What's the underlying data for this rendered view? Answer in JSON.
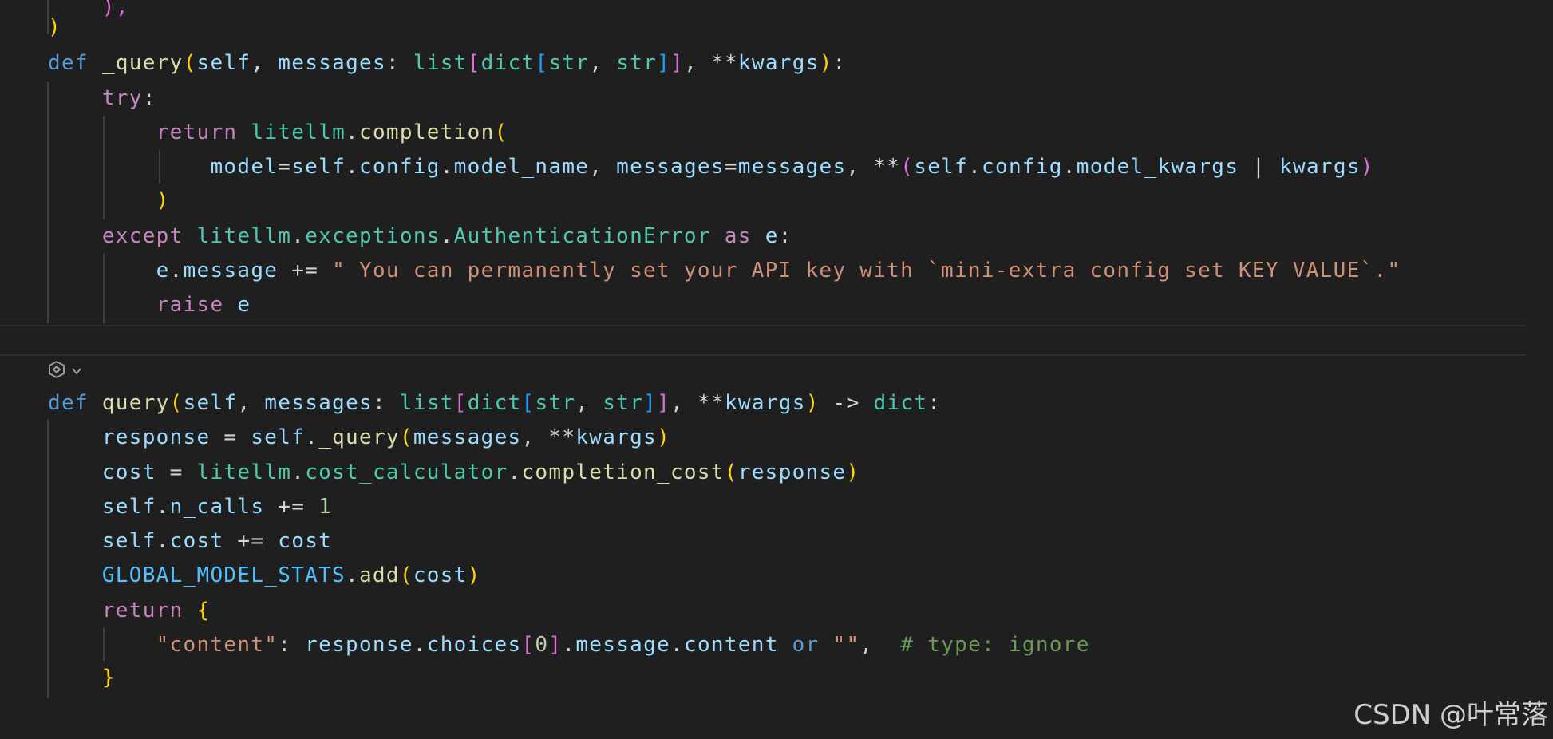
{
  "editor": {
    "codelens": {
      "icon": "ai-sparkle-icon",
      "caret_icon": "chevron-down-icon"
    },
    "lines": [
      {
        "tokens": [
          {
            "text": "    ",
            "style": "op"
          },
          {
            "text": "),",
            "style": "b2"
          }
        ]
      },
      {
        "tokens": [
          {
            "text": ")",
            "style": "b1"
          }
        ]
      },
      {
        "tokens": [
          {
            "text": "def",
            "style": "def"
          },
          {
            "text": " ",
            "style": "op"
          },
          {
            "text": "_query",
            "style": "fn"
          },
          {
            "text": "(",
            "style": "b1"
          },
          {
            "text": "self",
            "style": "var"
          },
          {
            "text": ", ",
            "style": "op"
          },
          {
            "text": "messages",
            "style": "var"
          },
          {
            "text": ": ",
            "style": "op"
          },
          {
            "text": "list",
            "style": "type"
          },
          {
            "text": "[",
            "style": "b2"
          },
          {
            "text": "dict",
            "style": "type"
          },
          {
            "text": "[",
            "style": "b3"
          },
          {
            "text": "str",
            "style": "type"
          },
          {
            "text": ", ",
            "style": "op"
          },
          {
            "text": "str",
            "style": "type"
          },
          {
            "text": "]",
            "style": "b3"
          },
          {
            "text": "]",
            "style": "b2"
          },
          {
            "text": ", ",
            "style": "op"
          },
          {
            "text": "**",
            "style": "op"
          },
          {
            "text": "kwargs",
            "style": "var"
          },
          {
            "text": ")",
            "style": "b1"
          },
          {
            "text": ":",
            "style": "op"
          }
        ]
      },
      {
        "tokens": [
          {
            "text": "    ",
            "style": "op"
          },
          {
            "text": "try",
            "style": "ctrl"
          },
          {
            "text": ":",
            "style": "op"
          }
        ]
      },
      {
        "tokens": [
          {
            "text": "        ",
            "style": "op"
          },
          {
            "text": "return",
            "style": "ctrl"
          },
          {
            "text": " ",
            "style": "op"
          },
          {
            "text": "litellm",
            "style": "type"
          },
          {
            "text": ".",
            "style": "op"
          },
          {
            "text": "completion",
            "style": "fn"
          },
          {
            "text": "(",
            "style": "b1"
          }
        ]
      },
      {
        "tokens": [
          {
            "text": "            ",
            "style": "op"
          },
          {
            "text": "model",
            "style": "var"
          },
          {
            "text": "=",
            "style": "op"
          },
          {
            "text": "self",
            "style": "var"
          },
          {
            "text": ".",
            "style": "op"
          },
          {
            "text": "config",
            "style": "var"
          },
          {
            "text": ".",
            "style": "op"
          },
          {
            "text": "model_name",
            "style": "var"
          },
          {
            "text": ", ",
            "style": "op"
          },
          {
            "text": "messages",
            "style": "var"
          },
          {
            "text": "=",
            "style": "op"
          },
          {
            "text": "messages",
            "style": "var"
          },
          {
            "text": ", ",
            "style": "op"
          },
          {
            "text": "**",
            "style": "op"
          },
          {
            "text": "(",
            "style": "b2"
          },
          {
            "text": "self",
            "style": "var"
          },
          {
            "text": ".",
            "style": "op"
          },
          {
            "text": "config",
            "style": "var"
          },
          {
            "text": ".",
            "style": "op"
          },
          {
            "text": "model_kwargs",
            "style": "var"
          },
          {
            "text": " | ",
            "style": "op"
          },
          {
            "text": "kwargs",
            "style": "var"
          },
          {
            "text": ")",
            "style": "b2"
          }
        ]
      },
      {
        "tokens": [
          {
            "text": "        ",
            "style": "op"
          },
          {
            "text": ")",
            "style": "b1"
          }
        ]
      },
      {
        "tokens": [
          {
            "text": "    ",
            "style": "op"
          },
          {
            "text": "except",
            "style": "ctrl"
          },
          {
            "text": " ",
            "style": "op"
          },
          {
            "text": "litellm",
            "style": "type"
          },
          {
            "text": ".",
            "style": "op"
          },
          {
            "text": "exceptions",
            "style": "type"
          },
          {
            "text": ".",
            "style": "op"
          },
          {
            "text": "AuthenticationError",
            "style": "type"
          },
          {
            "text": " ",
            "style": "op"
          },
          {
            "text": "as",
            "style": "ctrl"
          },
          {
            "text": " ",
            "style": "op"
          },
          {
            "text": "e",
            "style": "var"
          },
          {
            "text": ":",
            "style": "op"
          }
        ]
      },
      {
        "tokens": [
          {
            "text": "        ",
            "style": "op"
          },
          {
            "text": "e",
            "style": "var"
          },
          {
            "text": ".",
            "style": "op"
          },
          {
            "text": "message",
            "style": "var"
          },
          {
            "text": " += ",
            "style": "op"
          },
          {
            "text": "\" You can permanently set your API key with `mini-extra config set KEY VALUE`.\"",
            "style": "str"
          }
        ]
      },
      {
        "tokens": [
          {
            "text": "        ",
            "style": "op"
          },
          {
            "text": "raise",
            "style": "ctrl"
          },
          {
            "text": " ",
            "style": "op"
          },
          {
            "text": "e",
            "style": "var"
          }
        ]
      },
      {
        "tokens": [
          {
            "text": "def",
            "style": "def"
          },
          {
            "text": " ",
            "style": "op"
          },
          {
            "text": "query",
            "style": "fn"
          },
          {
            "text": "(",
            "style": "b1"
          },
          {
            "text": "self",
            "style": "var"
          },
          {
            "text": ", ",
            "style": "op"
          },
          {
            "text": "messages",
            "style": "var"
          },
          {
            "text": ": ",
            "style": "op"
          },
          {
            "text": "list",
            "style": "type"
          },
          {
            "text": "[",
            "style": "b2"
          },
          {
            "text": "dict",
            "style": "type"
          },
          {
            "text": "[",
            "style": "b3"
          },
          {
            "text": "str",
            "style": "type"
          },
          {
            "text": ", ",
            "style": "op"
          },
          {
            "text": "str",
            "style": "type"
          },
          {
            "text": "]",
            "style": "b3"
          },
          {
            "text": "]",
            "style": "b2"
          },
          {
            "text": ", ",
            "style": "op"
          },
          {
            "text": "**",
            "style": "op"
          },
          {
            "text": "kwargs",
            "style": "var"
          },
          {
            "text": ")",
            "style": "b1"
          },
          {
            "text": " -> ",
            "style": "op"
          },
          {
            "text": "dict",
            "style": "type"
          },
          {
            "text": ":",
            "style": "op"
          }
        ]
      },
      {
        "tokens": [
          {
            "text": "    ",
            "style": "op"
          },
          {
            "text": "response",
            "style": "var"
          },
          {
            "text": " = ",
            "style": "op"
          },
          {
            "text": "self",
            "style": "var"
          },
          {
            "text": ".",
            "style": "op"
          },
          {
            "text": "_query",
            "style": "fn"
          },
          {
            "text": "(",
            "style": "b1"
          },
          {
            "text": "messages",
            "style": "var"
          },
          {
            "text": ", ",
            "style": "op"
          },
          {
            "text": "**",
            "style": "op"
          },
          {
            "text": "kwargs",
            "style": "var"
          },
          {
            "text": ")",
            "style": "b1"
          }
        ]
      },
      {
        "tokens": [
          {
            "text": "    ",
            "style": "op"
          },
          {
            "text": "cost",
            "style": "var"
          },
          {
            "text": " = ",
            "style": "op"
          },
          {
            "text": "litellm",
            "style": "type"
          },
          {
            "text": ".",
            "style": "op"
          },
          {
            "text": "cost_calculator",
            "style": "type"
          },
          {
            "text": ".",
            "style": "op"
          },
          {
            "text": "completion_cost",
            "style": "fn"
          },
          {
            "text": "(",
            "style": "b1"
          },
          {
            "text": "response",
            "style": "var"
          },
          {
            "text": ")",
            "style": "b1"
          }
        ]
      },
      {
        "tokens": [
          {
            "text": "    ",
            "style": "op"
          },
          {
            "text": "self",
            "style": "var"
          },
          {
            "text": ".",
            "style": "op"
          },
          {
            "text": "n_calls",
            "style": "var"
          },
          {
            "text": " += ",
            "style": "op"
          },
          {
            "text": "1",
            "style": "num"
          }
        ]
      },
      {
        "tokens": [
          {
            "text": "    ",
            "style": "op"
          },
          {
            "text": "self",
            "style": "var"
          },
          {
            "text": ".",
            "style": "op"
          },
          {
            "text": "cost",
            "style": "var"
          },
          {
            "text": " += ",
            "style": "op"
          },
          {
            "text": "cost",
            "style": "var"
          }
        ]
      },
      {
        "tokens": [
          {
            "text": "    ",
            "style": "op"
          },
          {
            "text": "GLOBAL_MODEL_STATS",
            "style": "const"
          },
          {
            "text": ".",
            "style": "op"
          },
          {
            "text": "add",
            "style": "fn"
          },
          {
            "text": "(",
            "style": "b1"
          },
          {
            "text": "cost",
            "style": "var"
          },
          {
            "text": ")",
            "style": "b1"
          }
        ]
      },
      {
        "tokens": [
          {
            "text": "    ",
            "style": "op"
          },
          {
            "text": "return",
            "style": "ctrl"
          },
          {
            "text": " ",
            "style": "op"
          },
          {
            "text": "{",
            "style": "b1"
          }
        ]
      },
      {
        "tokens": [
          {
            "text": "        ",
            "style": "op"
          },
          {
            "text": "\"content\"",
            "style": "str"
          },
          {
            "text": ": ",
            "style": "op"
          },
          {
            "text": "response",
            "style": "var"
          },
          {
            "text": ".",
            "style": "op"
          },
          {
            "text": "choices",
            "style": "var"
          },
          {
            "text": "[",
            "style": "b2"
          },
          {
            "text": "0",
            "style": "num"
          },
          {
            "text": "]",
            "style": "b2"
          },
          {
            "text": ".",
            "style": "op"
          },
          {
            "text": "message",
            "style": "var"
          },
          {
            "text": ".",
            "style": "op"
          },
          {
            "text": "content",
            "style": "var"
          },
          {
            "text": " ",
            "style": "op"
          },
          {
            "text": "or",
            "style": "def"
          },
          {
            "text": " ",
            "style": "op"
          },
          {
            "text": "\"\"",
            "style": "str"
          },
          {
            "text": ",  ",
            "style": "op"
          },
          {
            "text": "# type: ignore",
            "style": "cmt"
          }
        ]
      },
      {
        "tokens": [
          {
            "text": "    ",
            "style": "op"
          },
          {
            "text": "}",
            "style": "b1"
          }
        ]
      }
    ]
  },
  "watermark": {
    "text": "CSDN @叶常落"
  }
}
